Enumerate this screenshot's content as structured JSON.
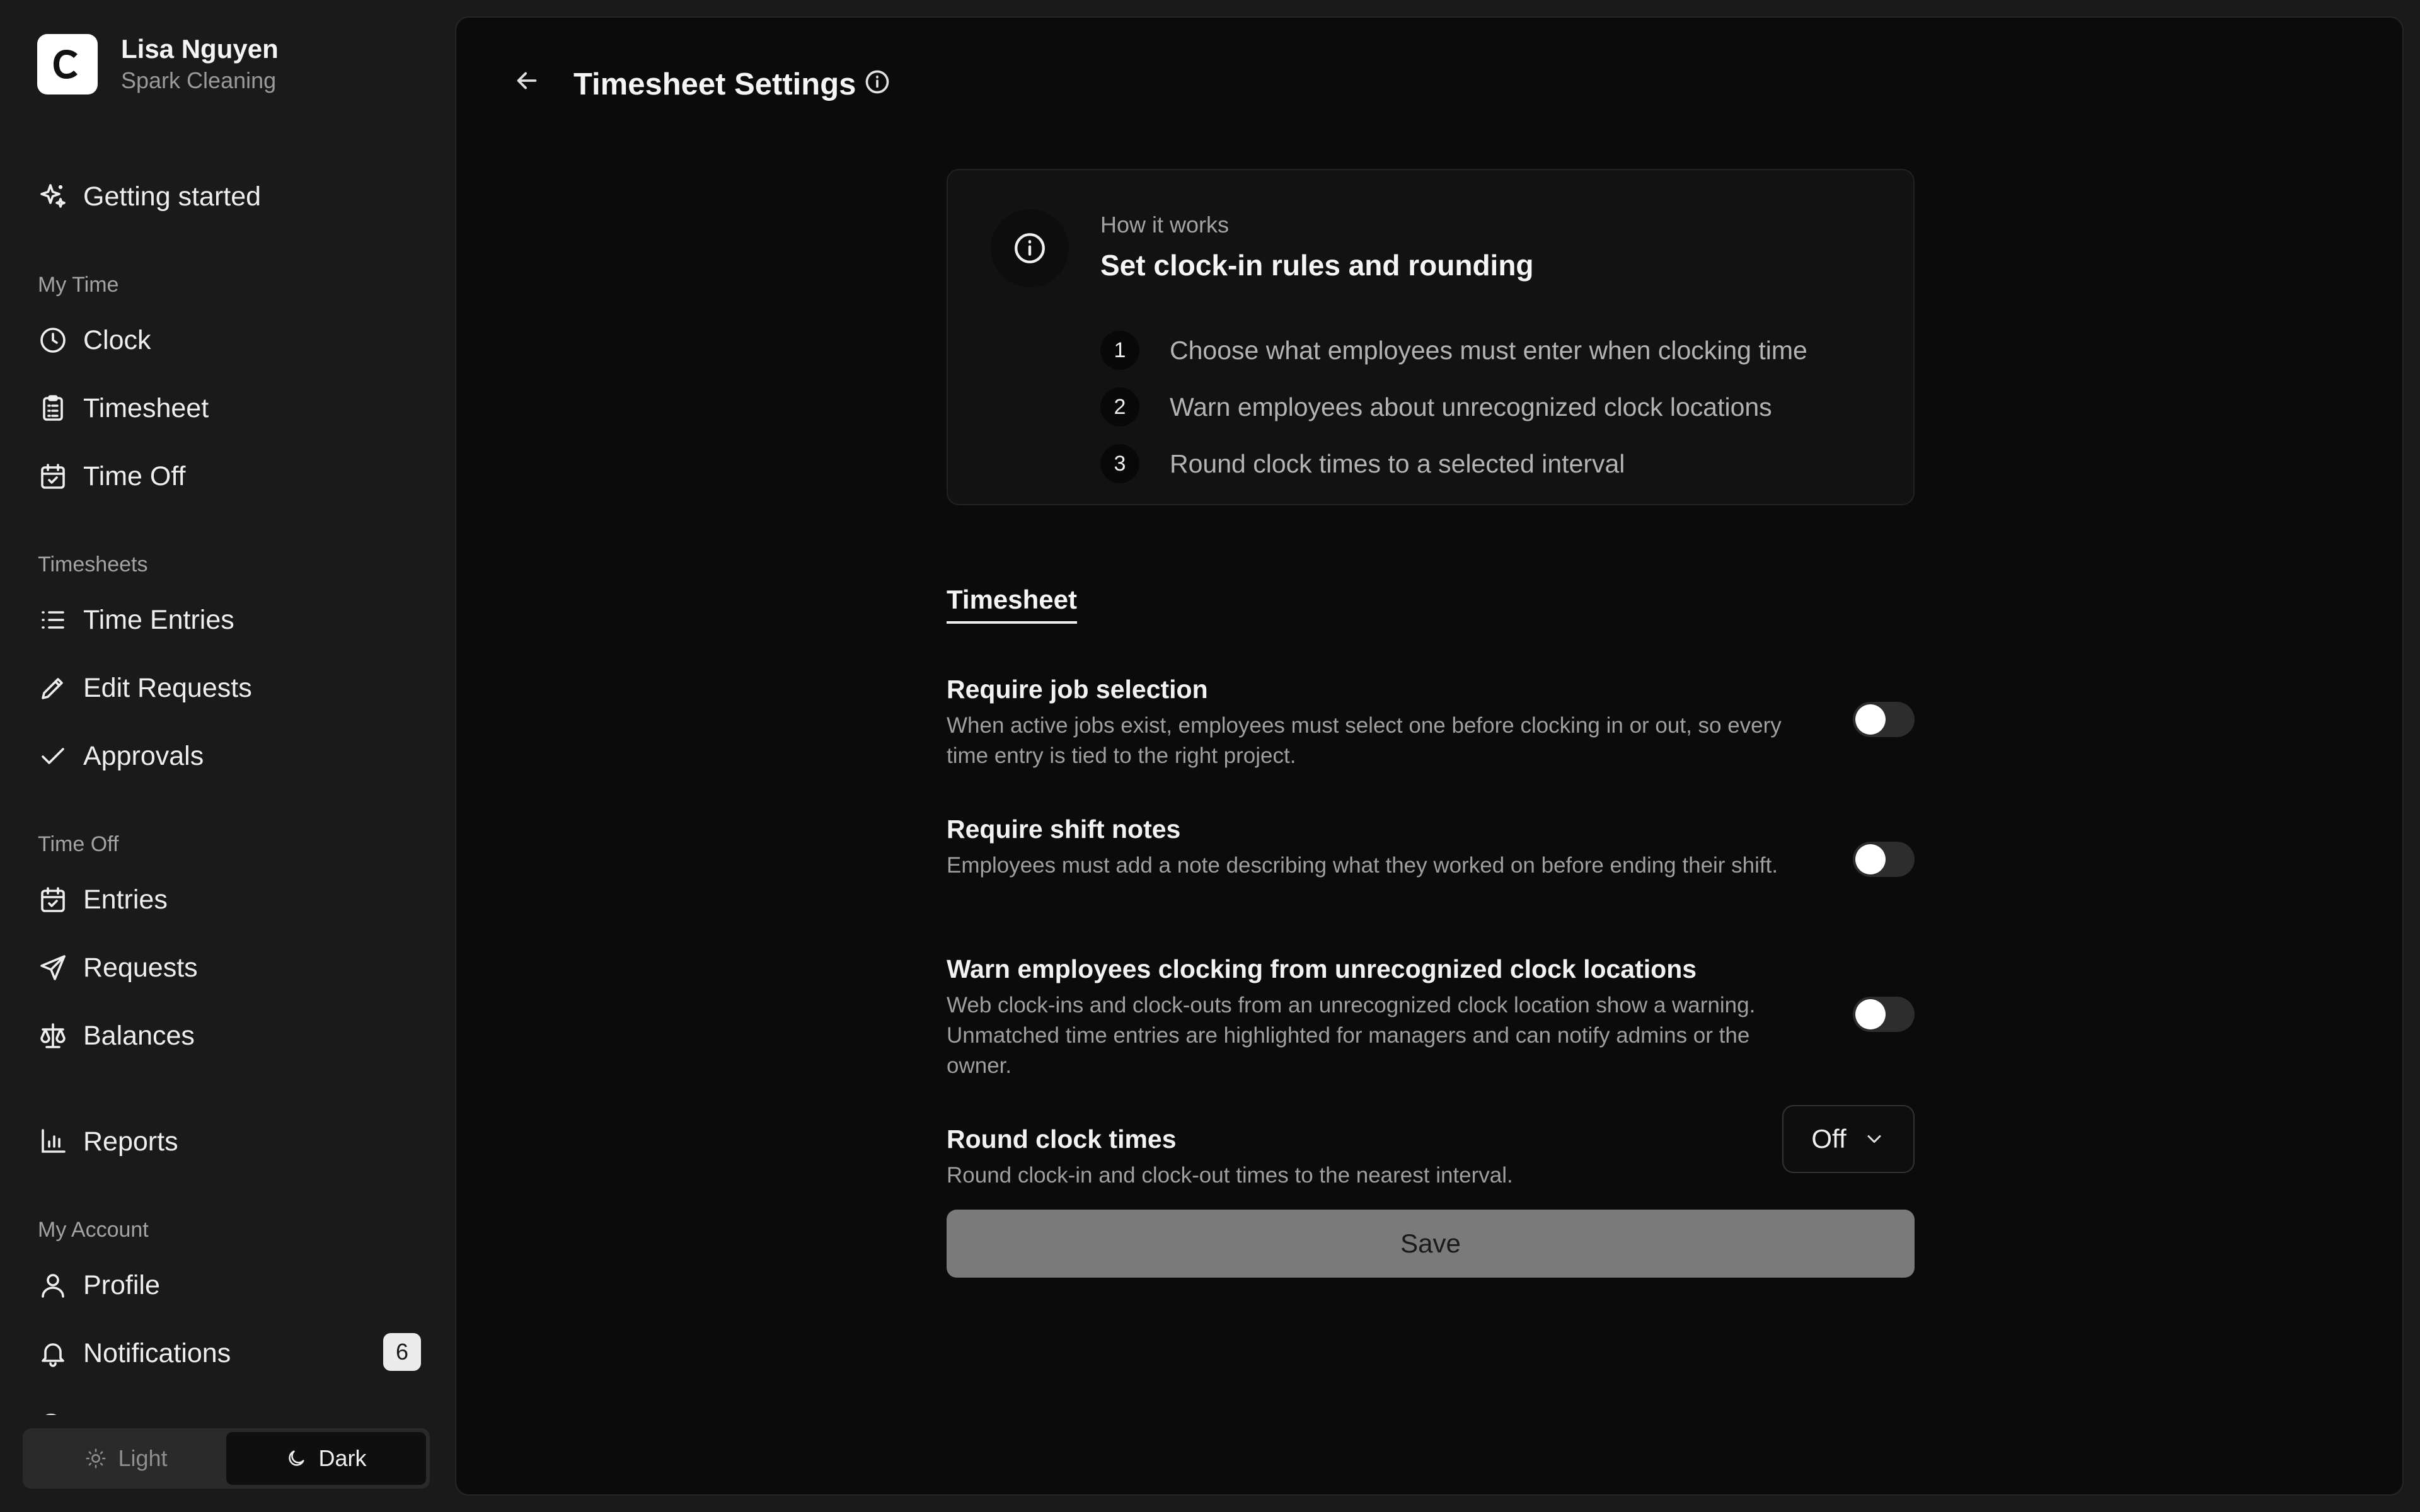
{
  "user": {
    "name": "Lisa Nguyen",
    "company": "Spark Cleaning",
    "logo_letter": "C"
  },
  "sidebar": {
    "getting_started": "Getting started",
    "sections": [
      {
        "title": "My Time",
        "items": [
          "Clock",
          "Timesheet",
          "Time Off"
        ]
      },
      {
        "title": "Timesheets",
        "items": [
          "Time Entries",
          "Edit Requests",
          "Approvals"
        ]
      },
      {
        "title": "Time Off",
        "items": [
          "Entries",
          "Requests",
          "Balances"
        ]
      }
    ],
    "reports": "Reports",
    "account": {
      "title": "My Account",
      "profile": "Profile",
      "notifications": "Notifications",
      "notifications_count": "6"
    },
    "icons": [
      "sparkle-icon",
      "clock-icon",
      "clipboard-icon",
      "calendar-check-icon",
      "list-icon",
      "pencil-icon",
      "check-icon",
      "calendar-check-icon",
      "send-icon",
      "scale-icon",
      "bar-chart-icon",
      "user-icon",
      "bell-icon"
    ]
  },
  "theme": {
    "light": "Light",
    "dark": "Dark",
    "active": "Dark"
  },
  "header": {
    "title": "Timesheet Settings"
  },
  "info_card": {
    "eyebrow": "How it works",
    "heading": "Set clock-in rules and rounding",
    "steps": [
      {
        "num": "1",
        "text": "Choose what employees must enter when clocking time"
      },
      {
        "num": "2",
        "text": "Warn employees about unrecognized clock locations"
      },
      {
        "num": "3",
        "text": "Round clock times to a selected interval"
      }
    ]
  },
  "tab": "Timesheet",
  "settings": [
    {
      "title": "Require job selection",
      "desc": "When active jobs exist, employees must select one before clocking in or out, so every time entry is tied to the right project.",
      "enabled": false
    },
    {
      "title": "Require shift notes",
      "desc": "Employees must add a note describing what they worked on before ending their shift.",
      "enabled": false
    },
    {
      "title": "Warn employees clocking from unrecognized clock locations",
      "desc": "Web clock-ins and clock-outs from an unrecognized clock location show a warning. Unmatched time entries are highlighted for managers and can notify admins or the owner.",
      "enabled": false
    },
    {
      "title": "Round clock times",
      "desc": "Round clock-in and clock-out times to the nearest interval.",
      "value": "Off"
    }
  ],
  "save_label": "Save"
}
